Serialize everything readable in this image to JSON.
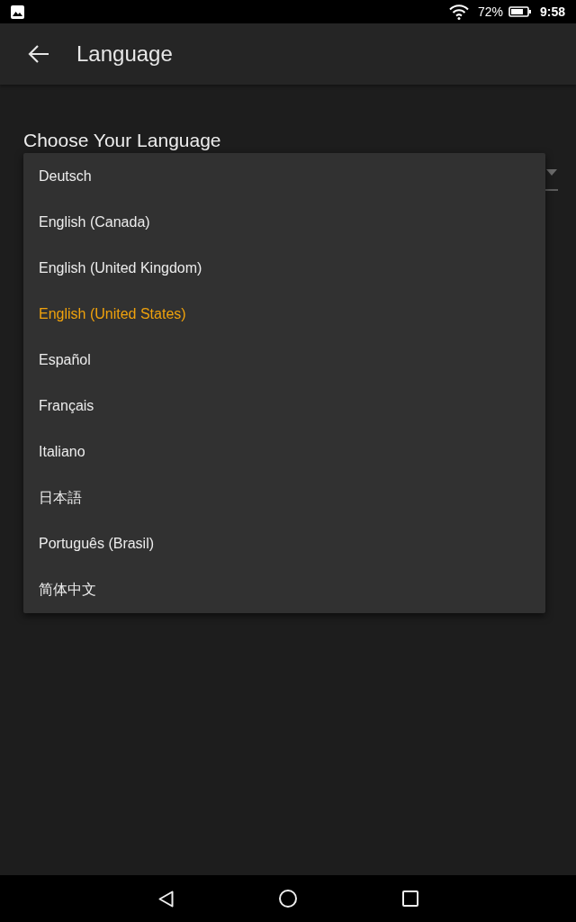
{
  "status_bar": {
    "battery": "72%",
    "time": "9:58"
  },
  "app_bar": {
    "title": "Language"
  },
  "section": {
    "heading": "Choose Your Language"
  },
  "language_menu": {
    "items": [
      {
        "label": "Deutsch",
        "selected": false
      },
      {
        "label": "English (Canada)",
        "selected": false
      },
      {
        "label": "English (United Kingdom)",
        "selected": false
      },
      {
        "label": "English (United States)",
        "selected": true
      },
      {
        "label": "Español",
        "selected": false
      },
      {
        "label": "Français",
        "selected": false
      },
      {
        "label": "Italiano",
        "selected": false
      },
      {
        "label": "日本語",
        "selected": false
      },
      {
        "label": "Português (Brasil)",
        "selected": false
      },
      {
        "label": "简体中文",
        "selected": false
      }
    ]
  }
}
